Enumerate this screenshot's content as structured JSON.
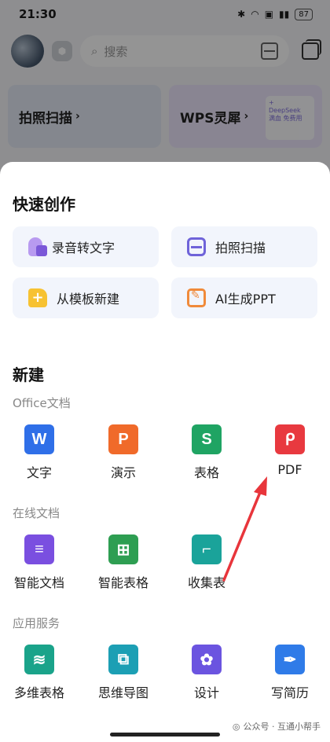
{
  "status_bar": {
    "time": "21:30",
    "battery": "87"
  },
  "top": {
    "search_placeholder": "搜索"
  },
  "banners": [
    {
      "label": "拍照扫描"
    },
    {
      "label": "WPS灵犀",
      "deco_line1": "+",
      "deco_line2": "DeepSeek",
      "deco_line3": "满血 免费用"
    }
  ],
  "sheet": {
    "quick_title": "快速创作",
    "quick_items": [
      {
        "label": "录音转文字",
        "icon": "voice-to-text-icon"
      },
      {
        "label": "拍照扫描",
        "icon": "scan-icon"
      },
      {
        "label": "从模板新建",
        "icon": "template-icon"
      },
      {
        "label": "AI生成PPT",
        "icon": "ai-ppt-icon"
      }
    ],
    "new_title": "新建",
    "office_title": "Office文档",
    "office_items": [
      {
        "label": "文字",
        "glyph": "W",
        "color": "#2f6fe8"
      },
      {
        "label": "演示",
        "glyph": "P",
        "color": "#f06a2a"
      },
      {
        "label": "表格",
        "glyph": "S",
        "color": "#1fa463"
      },
      {
        "label": "PDF",
        "glyph": "ᑭ",
        "color": "#e8393f"
      }
    ],
    "online_title": "在线文档",
    "online_items": [
      {
        "label": "智能文档",
        "glyph": "≡",
        "color": "#7a4fe0"
      },
      {
        "label": "智能表格",
        "glyph": "⊞",
        "color": "#2e9e52"
      },
      {
        "label": "收集表",
        "glyph": "⌐",
        "color": "#1aa39a"
      }
    ],
    "service_title": "应用服务",
    "service_items": [
      {
        "label": "多维表格",
        "glyph": "≋",
        "color": "#1aa38a"
      },
      {
        "label": "思维导图",
        "glyph": "⧉",
        "color": "#1c9fb4"
      },
      {
        "label": "设计",
        "glyph": "✿",
        "color": "#6b54e0"
      },
      {
        "label": "写简历",
        "glyph": "✒",
        "color": "#2f7be8"
      }
    ]
  },
  "watermark": {
    "text": "公众号 · 互通小帮手"
  }
}
